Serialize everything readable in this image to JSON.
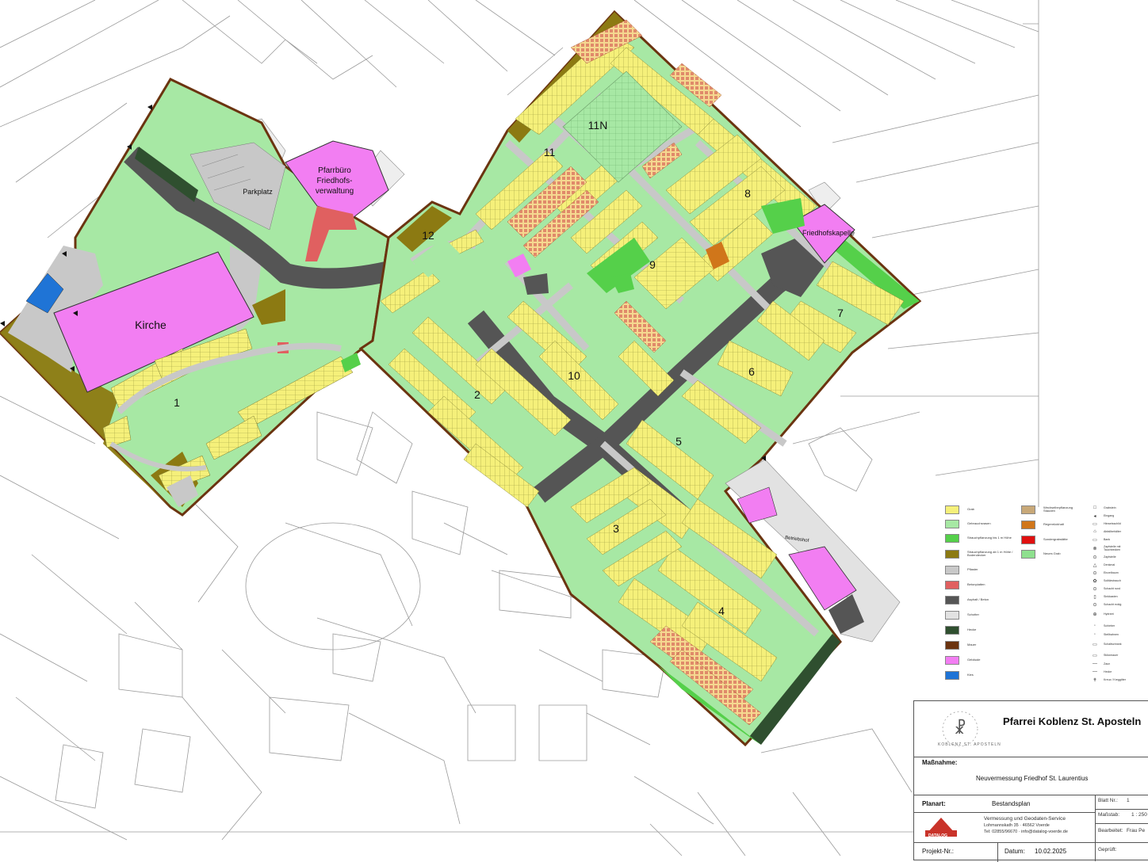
{
  "map": {
    "area_labels": {
      "kirche": "Kirche",
      "parkplatz": "Parkplatz",
      "pfarrbuero_line1": "Pfarrbüro",
      "pfarrbuero_line2": "Friedhofs-",
      "pfarrbuero_line3": "verwaltung",
      "friedhofskapelle": "Friedhofskapelle",
      "betriebshof": "Betriebshof"
    },
    "field_numbers": [
      "1",
      "2",
      "3",
      "4",
      "5",
      "6",
      "7",
      "8",
      "9",
      "10",
      "11",
      "11N",
      "12"
    ],
    "colors": {
      "grab": "#f5f07a",
      "gebrauchsrasen": "#a7e8a4",
      "strauch_low": "#55d04a",
      "strauch_high": "#8c7a12",
      "pflaster": "#c8c8c8",
      "betonplatten": "#e06060",
      "asphalt": "#555555",
      "schotter": "#e2e2e2",
      "hecke": "#2f4f2f",
      "mauer": "#6b3410",
      "gebaeude": "#f27ef2",
      "kies": "#1f74d6",
      "wechselbepflanzung": "#c8a878",
      "regenrueckhalt": "#d0761a",
      "sondergrabstaette": "#e01010",
      "neues_grab": "#8ee08e",
      "parcel_line": "#9a9a9a"
    }
  },
  "legend": {
    "areas": [
      {
        "label": "Grab",
        "color": "#f5f07a"
      },
      {
        "label": "Gebrauchsrasen",
        "color": "#a7e8a4"
      },
      {
        "label": "Strauchpflanzung bis 1 m Höhe",
        "color": "#55d04a"
      },
      {
        "label": "Strauchpflanzung ab 1 m Höhe / Bodendecker",
        "color": "#8c7a12"
      },
      {
        "label": "Pflaster",
        "color": "#c8c8c8"
      },
      {
        "label": "Betonplatten",
        "color": "#e06060"
      },
      {
        "label": "Asphalt / Beton",
        "color": "#555555"
      },
      {
        "label": "Schotter",
        "color": "#e2e2e2"
      },
      {
        "label": "Hecke",
        "color": "#2f4f2f"
      },
      {
        "label": "Mauer",
        "color": "#6b3410"
      },
      {
        "label": "Gebäude",
        "color": "#f27ef2"
      },
      {
        "label": "Kies",
        "color": "#1f74d6"
      }
    ],
    "areas2": [
      {
        "label": "Wechselbepflanzung Stauden",
        "color": "#c8a878"
      },
      {
        "label": "Regenrückhalt",
        "color": "#d0761a"
      },
      {
        "label": "Sondergrabstätte",
        "color": "#e01010"
      },
      {
        "label": "Neues Grab",
        "color": "#8ee08e"
      }
    ],
    "symbols": [
      {
        "icon": "□",
        "label": "Grabstein"
      },
      {
        "icon": "◂",
        "label": "Eingang"
      },
      {
        "icon": "▭",
        "label": "Hinweisschild"
      },
      {
        "icon": "⌂",
        "label": "Abfallbehälter"
      },
      {
        "icon": "▭",
        "label": "Bank"
      },
      {
        "icon": "⊗",
        "label": "Zapfstelle mit Tauchbecken"
      },
      {
        "icon": "⊙",
        "label": "Zapfstelle"
      },
      {
        "icon": "△",
        "label": "Denkmal"
      },
      {
        "icon": "⊙",
        "label": "Einzelbaum"
      },
      {
        "icon": "✿",
        "label": "Solitärstrauch"
      },
      {
        "icon": "⊙",
        "label": "Schacht rund"
      },
      {
        "icon": "▯",
        "label": "Sinkkasten"
      },
      {
        "icon": "⊙",
        "label": "Schacht eckig"
      },
      {
        "icon": "⊕",
        "label": "Hydrant"
      },
      {
        "icon": "◦",
        "label": "Schieber"
      },
      {
        "icon": "◦",
        "label": "Stellbahnen"
      },
      {
        "icon": "▭",
        "label": "Schaltschrank"
      },
      {
        "icon": "▭",
        "label": "Stützmauer"
      },
      {
        "icon": "—",
        "label": "Zaun"
      },
      {
        "icon": "—",
        "label": "Hecke"
      },
      {
        "icon": "✝",
        "label": "Kreuz / Kreggitter"
      }
    ]
  },
  "titleblock": {
    "org": "Pfarrei Koblenz St. Aposteln",
    "logo_text": "KOBLENZ ST. APOSTELN",
    "massnahme_label": "Maßnahme:",
    "massnahme_value": "Neuvermessung Friedhof St. Laurentius",
    "planart_label": "Planart:",
    "planart_value": "Bestandsplan",
    "blatt_label": "Blatt Nr.:",
    "blatt_value": "1",
    "massstab_label": "Maßstab:",
    "massstab_value": "1 : 250",
    "bearbeitet_label": "Bearbeitet:",
    "bearbeitet_value": "Frau Pe",
    "company_logo": "DATALOG",
    "company_name": "Vermessung und Geodaten-Service",
    "company_addr": "Lohmannskath 35  ·  46562 Voerde",
    "company_contact": "Tel: 02855/96670  ·  info@datalog-voerde.de",
    "projekt_label": "Projekt-Nr.:",
    "datum_label": "Datum:",
    "datum_value": "10.02.2025",
    "geprueft_label": "Geprüft:"
  }
}
